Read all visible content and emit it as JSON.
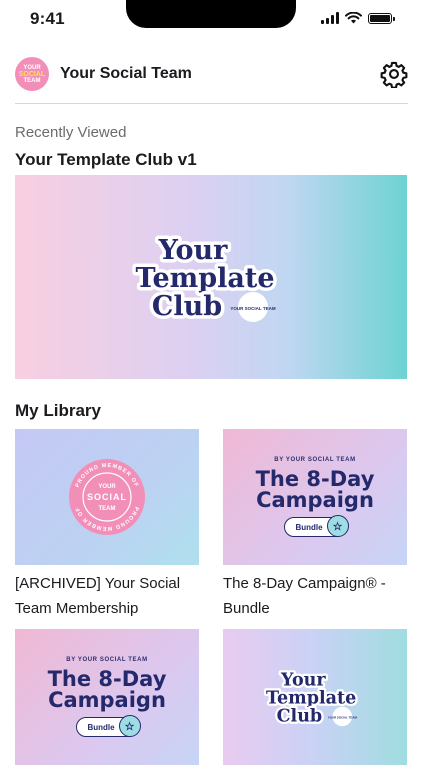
{
  "status_bar": {
    "time": "9:41"
  },
  "header": {
    "team_name": "Your Social Team",
    "avatar": {
      "line1": "YOUR",
      "line2": "SOCIAL",
      "line3": "TEAM"
    }
  },
  "recently_viewed": {
    "section_label": "Recently Viewed",
    "title": "Your Template Club v1",
    "logo": {
      "line1": "Your",
      "line2": "Template",
      "line3": "Club",
      "badge": "YOUR SOCIAL TEAM"
    }
  },
  "library": {
    "title": "My Library",
    "items": [
      {
        "label": "[ARCHIVED] Your Social Team Membership",
        "badge": {
          "ring_top": "PROUND MEMBER OF",
          "ring_bottom": "PROUND MEMBER OF",
          "line1": "YOUR",
          "line2": "SOCIAL",
          "line3": "TEAM"
        }
      },
      {
        "label": "The 8-Day Campaign® - Bundle",
        "by_line": "BY YOUR SOCIAL TEAM",
        "title_line1": "The 8-Day",
        "title_line2": "Campaign",
        "pill": "Bundle"
      },
      {
        "by_line": "BY YOUR SOCIAL TEAM",
        "title_line1": "The 8-Day",
        "title_line2": "Campaign",
        "pill": "Bundle"
      },
      {
        "logo": {
          "line1": "Your",
          "line2": "Template",
          "line3": "Club",
          "badge": "YOUR SOCIAL TEAM"
        }
      }
    ]
  },
  "colors": {
    "brand_navy": "#24296b",
    "brand_pink": "#f28fb8",
    "divider": "#d8d8dc"
  }
}
